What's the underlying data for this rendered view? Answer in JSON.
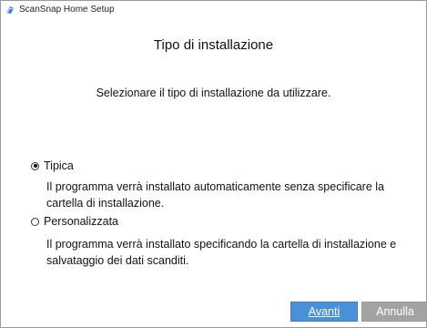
{
  "window": {
    "title": "ScanSnap Home Setup",
    "app_icon": "scansnap-icon"
  },
  "page": {
    "heading": "Tipo di installazione",
    "instruction": "Selezionare il tipo di installazione da utilizzare."
  },
  "options": [
    {
      "label": "Tipica",
      "selected": true,
      "description_line1": "Il programma verrà installato automaticamente senza specificare la",
      "description_line2": "cartella di installazione."
    },
    {
      "label": "Personalizzata",
      "selected": false,
      "description_line1": "Il programma verrà installato specificando la cartella di installazione e",
      "description_line2": "salvataggio dei dati scanditi."
    }
  ],
  "buttons": {
    "next_label": "Avanti",
    "cancel_label": "Annulla",
    "cancel_enabled": false
  },
  "colors": {
    "primary_button": "#4a90d9",
    "disabled_button": "#a3a3a3"
  }
}
